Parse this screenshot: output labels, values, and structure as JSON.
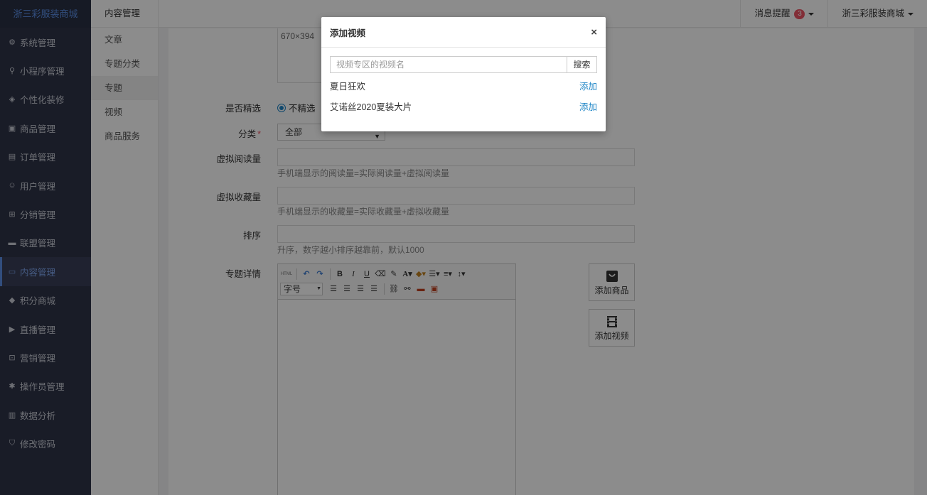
{
  "brand": "浙三彩服装商城",
  "sidebar": {
    "items": [
      {
        "label": "系统管理",
        "icon": "gear-icon",
        "glyph": "⚙"
      },
      {
        "label": "小程序管理",
        "icon": "link-icon",
        "glyph": "⚲"
      },
      {
        "label": "个性化装修",
        "icon": "diamond-icon",
        "glyph": "◈"
      },
      {
        "label": "商品管理",
        "icon": "bag-icon",
        "glyph": "▣"
      },
      {
        "label": "订单管理",
        "icon": "clipboard-icon",
        "glyph": "▤"
      },
      {
        "label": "用户管理",
        "icon": "user-icon",
        "glyph": "☺"
      },
      {
        "label": "分销管理",
        "icon": "sitemap-icon",
        "glyph": "⊞"
      },
      {
        "label": "联盟管理",
        "icon": "store-icon",
        "glyph": "▬"
      },
      {
        "label": "内容管理",
        "icon": "newspaper-icon",
        "glyph": "▭"
      },
      {
        "label": "积分商城",
        "icon": "cube-icon",
        "glyph": "◆"
      },
      {
        "label": "直播管理",
        "icon": "play-icon",
        "glyph": "▶"
      },
      {
        "label": "营销管理",
        "icon": "handshake-icon",
        "glyph": "⊡"
      },
      {
        "label": "操作员管理",
        "icon": "cog-icon",
        "glyph": "✱"
      },
      {
        "label": "数据分析",
        "icon": "bar-chart-icon",
        "glyph": "▥"
      },
      {
        "label": "修改密码",
        "icon": "shield-icon",
        "glyph": "⛉"
      }
    ]
  },
  "subnav": {
    "title": "内容管理",
    "items": [
      "文章",
      "专题分类",
      "专题",
      "视频",
      "商品服务"
    ]
  },
  "topbar": {
    "messages_label": "消息提醒",
    "messages_count": "3",
    "account_label": "浙三彩服装商城"
  },
  "form": {
    "image_size": "670×394",
    "featured_label": "是否精选",
    "featured_value": "不精选",
    "category_label": "分类",
    "category_value": "全部",
    "virtual_reads_label": "虚拟阅读量",
    "virtual_reads_help": "手机端显示的阅读量=实际阅读量+虚拟阅读量",
    "virtual_favs_label": "虚拟收藏量",
    "virtual_favs_help": "手机端显示的收藏量=实际收藏量+虚拟收藏量",
    "sort_label": "排序",
    "sort_help": "升序，数字越小排序越靠前，默认1000",
    "detail_label": "专题详情",
    "editor_font_size": "字号",
    "add_goods_label": "添加商品",
    "add_video_label": "添加视频"
  },
  "modal": {
    "title": "添加视频",
    "close": "×",
    "search_placeholder": "视频专区的视频名",
    "search_button": "搜索",
    "videos": [
      {
        "name": "夏日狂欢",
        "action": "添加"
      },
      {
        "name": "艾诺丝2020夏装大片",
        "action": "添加"
      }
    ]
  }
}
